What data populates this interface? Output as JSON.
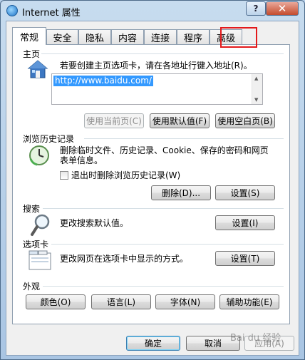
{
  "window": {
    "title": "Internet 属性",
    "help_label": "?",
    "close_label": "✕"
  },
  "tabs": [
    {
      "label": "常规",
      "active": true
    },
    {
      "label": "安全",
      "active": false
    },
    {
      "label": "隐私",
      "active": false
    },
    {
      "label": "内容",
      "active": false
    },
    {
      "label": "连接",
      "active": false
    },
    {
      "label": "程序",
      "active": false
    },
    {
      "label": "高级",
      "active": false
    }
  ],
  "home": {
    "title": "主页",
    "description": "若要创建主页选项卡，请在各地址行键入地址(R)。",
    "url": "http://www.baidu.com/",
    "buttons": {
      "use_current": "使用当前页(C)",
      "use_default": "使用默认值(F)",
      "use_blank": "使用空白页(B)"
    }
  },
  "history": {
    "title": "浏览历史记录",
    "description_line1": "删除临时文件、历史记录、Cookie、保存的密码和网页",
    "description_line2": "表单信息。",
    "checkbox_label": "退出时删除浏览历史记录(W)",
    "checkbox_checked": false,
    "delete_button": "删除(D)...",
    "settings_button": "设置(S)"
  },
  "search": {
    "title": "搜索",
    "description": "更改搜索默认值。",
    "settings_button": "设置(I)"
  },
  "tabs_section": {
    "title": "选项卡",
    "description": "更改网页在选项卡中显示的方式。",
    "settings_button": "设置(T)"
  },
  "appearance": {
    "title": "外观",
    "colors_button": "颜色(O)",
    "languages_button": "语言(L)",
    "fonts_button": "字体(N)",
    "accessibility_button": "辅助功能(E)"
  },
  "footer": {
    "ok_button": "确定",
    "cancel_button": "取消",
    "apply_button": "应用(A)"
  },
  "watermark_text": "Bai du 经验"
}
